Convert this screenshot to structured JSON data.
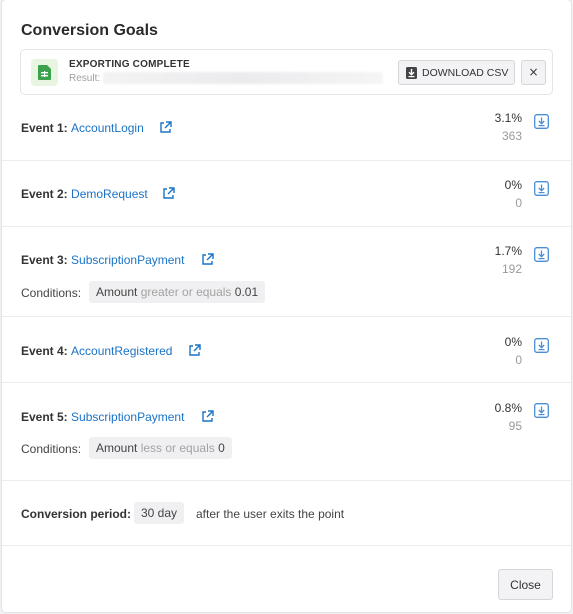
{
  "modal": {
    "title": "Conversion Goals"
  },
  "export": {
    "status": "EXPORTING COMPLETE",
    "result_label": "Result:",
    "download_label": "DOWNLOAD CSV",
    "close_glyph": "×"
  },
  "events": [
    {
      "label": "Event 1:",
      "name": "AccountLogin",
      "pct": "3.1%",
      "count": "363"
    },
    {
      "label": "Event 2:",
      "name": "DemoRequest",
      "pct": "0%",
      "count": "0"
    },
    {
      "label": "Event 3:",
      "name": "SubscriptionPayment",
      "pct": "1.7%",
      "count": "192",
      "condition": {
        "label": "Conditions:",
        "field": "Amount",
        "op": "greater or equals",
        "value": "0.01"
      }
    },
    {
      "label": "Event 4:",
      "name": "AccountRegistered",
      "pct": "0%",
      "count": "0"
    },
    {
      "label": "Event 5:",
      "name": "SubscriptionPayment",
      "pct": "0.8%",
      "count": "95",
      "condition": {
        "label": "Conditions:",
        "field": "Amount",
        "op": "less or equals",
        "value": "0"
      }
    }
  ],
  "period": {
    "label": "Conversion period:",
    "value": "30 day",
    "after": "after the user exits the point"
  },
  "footer": {
    "close_label": "Close"
  },
  "colors": {
    "link": "#1a73c6",
    "icon_blue": "#4a8fd6",
    "file_green": "#3aa24a"
  },
  "icons": {
    "file": "spreadsheet-icon",
    "download": "download-icon",
    "external": "external-link-icon",
    "row_download": "download-box-icon"
  }
}
